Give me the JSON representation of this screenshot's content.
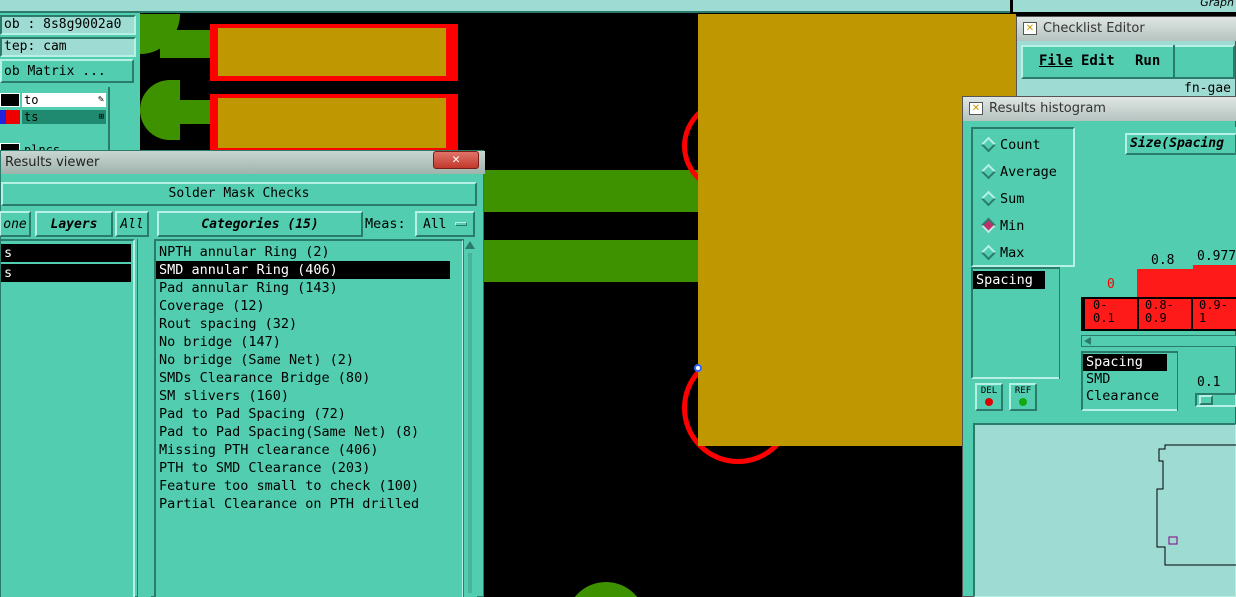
{
  "topbar": {
    "right_text": "Graph"
  },
  "left_panel": {
    "job_label": "ob : 8s8g9002a0",
    "step_label": "tep: cam",
    "job_matrix_button": "ob Matrix ...",
    "layers": [
      {
        "name": "to",
        "color": "#ffffff"
      },
      {
        "name": "ts",
        "color": "#1f8a6f"
      },
      {
        "name": "plncs",
        "color": "#52cdb0"
      }
    ]
  },
  "results_viewer": {
    "title": "Results viewer",
    "header": "Solder Mask Checks",
    "none_button": "one",
    "layers_button": "Layers",
    "all_button": "All",
    "categories_button": "Categories (15)",
    "meas_label": "Meas:",
    "meas_value": "All",
    "left_list": [
      "s",
      "s"
    ],
    "categories": [
      "NPTH annular Ring (2)",
      "SMD annular Ring (406)",
      "Pad annular Ring (143)",
      "Coverage (12)",
      "Rout spacing (32)",
      "No bridge (147)",
      "No bridge (Same Net) (2)",
      "SMDs Clearance Bridge (80)",
      "SM slivers (160)",
      "Pad to Pad Spacing (72)",
      "Pad to Pad Spacing(Same Net) (8)",
      "Missing PTH clearance (406)",
      "PTH to SMD Clearance (203)",
      "Feature too small to check (100)",
      "Partial Clearance on PTH drilled"
    ],
    "selected_index": 1
  },
  "checklist_editor": {
    "title": "Checklist Editor",
    "menu": [
      "File",
      "Edit",
      "Run"
    ],
    "right_text": "fn-gae"
  },
  "histogram": {
    "title": "Results histogram",
    "radio_options": [
      "Count",
      "Average",
      "Sum",
      "Min",
      "Max"
    ],
    "selected_radio": "Min",
    "size_label": "Size(Spacing",
    "bar_values": [
      "0",
      "0.8",
      "0.977"
    ],
    "bar_ranges": [
      "0-\n0.1",
      "0.8-\n0.9",
      "0.9-\n1"
    ],
    "list1": [
      "Spacing"
    ],
    "list2": [
      "Spacing",
      "SMD",
      "Clearance"
    ],
    "del_button": "DEL",
    "ref_button": "REF",
    "scale_value": "0.1",
    "colors": {
      "bar": "#ff1a1a",
      "bar_value_red": "#ff0000"
    }
  }
}
